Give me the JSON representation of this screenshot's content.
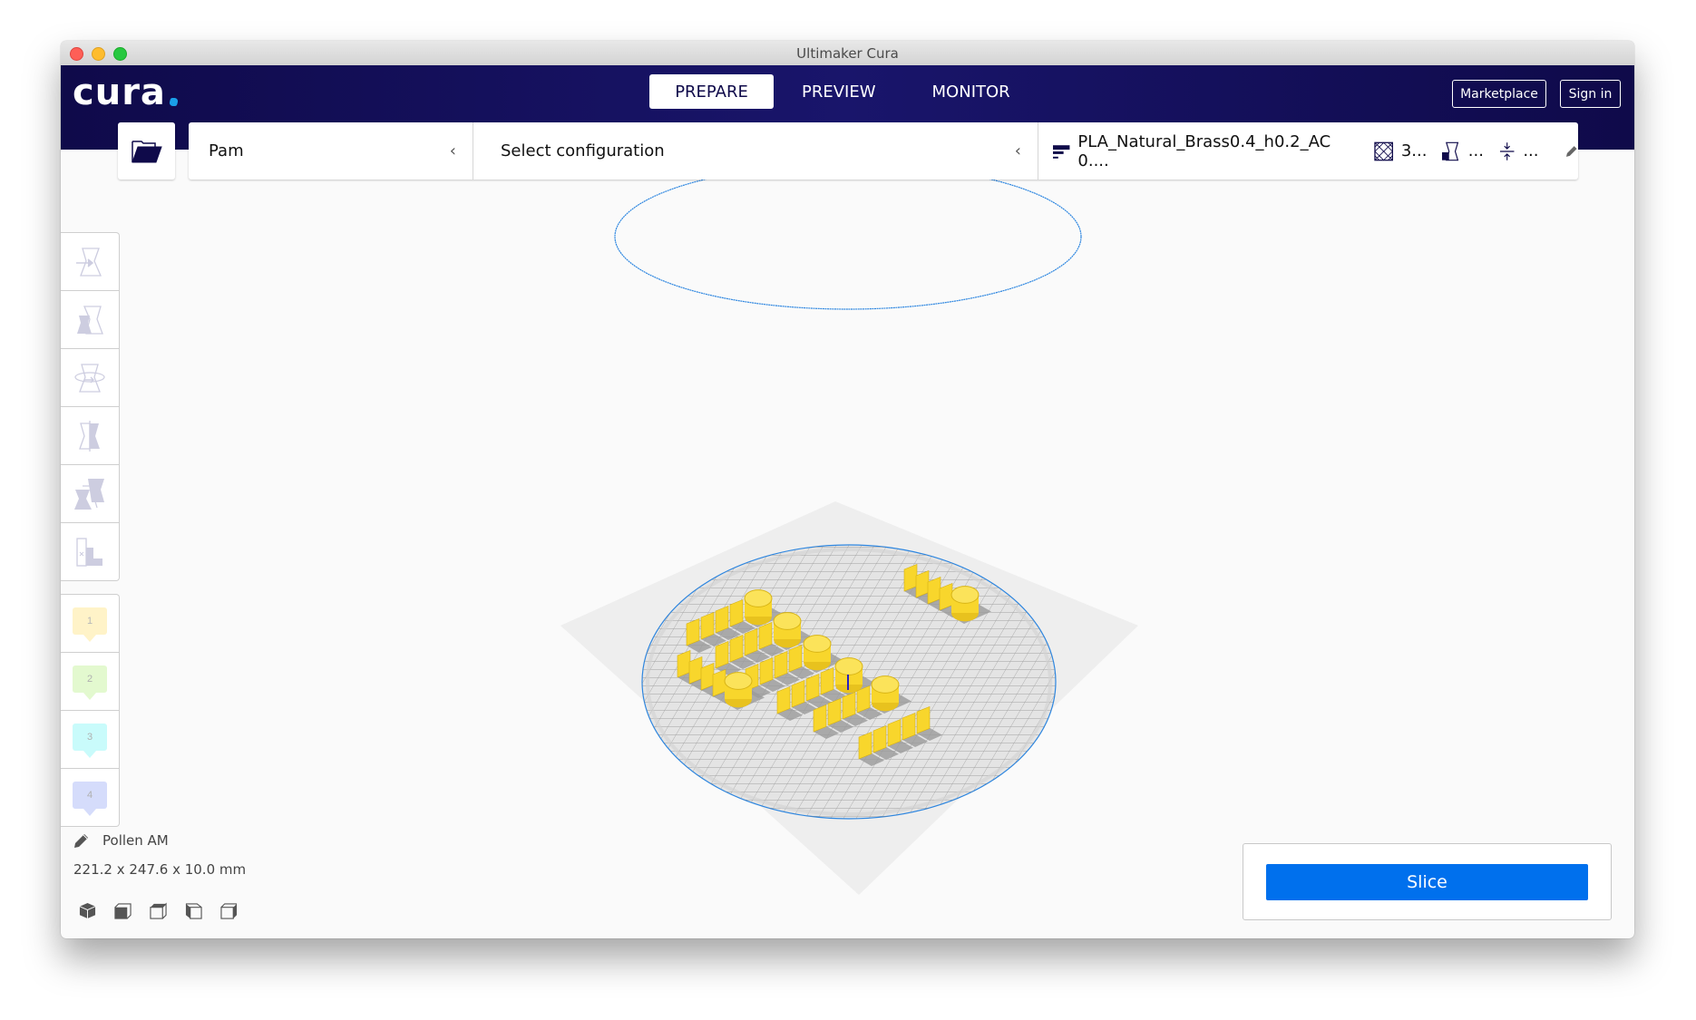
{
  "window": {
    "title": "Ultimaker Cura"
  },
  "header": {
    "logo": "cura",
    "tabs": [
      {
        "label": "PREPARE",
        "active": true
      },
      {
        "label": "PREVIEW",
        "active": false
      },
      {
        "label": "MONITOR",
        "active": false
      }
    ],
    "marketplace_label": "Marketplace",
    "signin_label": "Sign in"
  },
  "config_bar": {
    "open_file_icon": "folder-open-icon",
    "printer": "Pam",
    "configuration": "Select configuration",
    "profile": "PLA_Natural_Brass0.4_h0.2_AC 0....",
    "infill": "3...",
    "support": "...",
    "adhesion": "..."
  },
  "tools": [
    {
      "name": "move",
      "icon": "move-icon"
    },
    {
      "name": "scale",
      "icon": "scale-icon"
    },
    {
      "name": "rotate",
      "icon": "rotate-icon"
    },
    {
      "name": "mirror",
      "icon": "mirror-icon"
    },
    {
      "name": "per-model-settings",
      "icon": "per-model-settings-icon"
    },
    {
      "name": "support-blocker",
      "icon": "support-blocker-icon"
    }
  ],
  "extruders": [
    {
      "label": "1",
      "color": "#fff3c8"
    },
    {
      "label": "2",
      "color": "#e3f9cf"
    },
    {
      "label": "3",
      "color": "#c9fbfb"
    },
    {
      "label": "4",
      "color": "#d5dcfb"
    }
  ],
  "object_info": {
    "name": "Pollen AM",
    "dimensions": "221.2 x 247.6 x 10.0 mm"
  },
  "view_buttons": [
    "3d-view",
    "front-view",
    "top-view",
    "left-view",
    "right-view"
  ],
  "slice": {
    "label": "Slice"
  },
  "colors": {
    "header": "#120c4f",
    "accent": "#0070ed",
    "model": "#f8d62c",
    "buildvolume_outline": "#2d86e0"
  }
}
